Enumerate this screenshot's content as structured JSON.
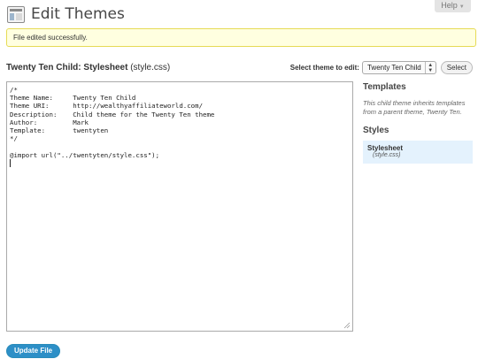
{
  "help": {
    "label": "Help",
    "chevron": "▼"
  },
  "header": {
    "title": "Edit Themes",
    "icon": "appearance-icon"
  },
  "notice": {
    "text": "File edited successfully."
  },
  "file_heading": {
    "title": "Twenty Ten Child: Stylesheet",
    "filename": "(style.css)"
  },
  "theme_select": {
    "label": "Select theme to edit:",
    "value": "Twenty Ten Child",
    "button": "Select"
  },
  "editor": {
    "lines": [
      "/*",
      "Theme Name:     Twenty Ten Child",
      "Theme URI:      http://wealthyaffiliateworld.com/",
      "Description:    Child theme for the Twenty Ten theme",
      "Author:         Mark",
      "Template:       twentyten",
      "*/",
      "",
      "@import url(\"../twentyten/style.css\");"
    ]
  },
  "sidebar": {
    "templates_heading": "Templates",
    "templates_desc": "This child theme inherits templates from a parent theme, Twenty Ten.",
    "styles_heading": "Styles",
    "files": [
      {
        "name": "Stylesheet",
        "path": "(style.css)"
      }
    ]
  },
  "update_button": {
    "label": "Update File"
  },
  "colors": {
    "notice_bg": "#ffffe0",
    "notice_border": "#e6db55",
    "primary_button": "#2d8fc7",
    "selected_file_bg": "#e4f2fd"
  }
}
